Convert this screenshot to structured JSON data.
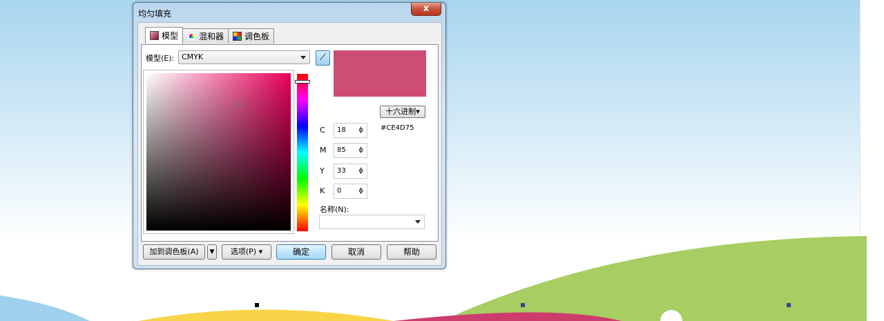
{
  "dialog": {
    "title": "均匀填充",
    "close_label": "x"
  },
  "tabs": [
    {
      "label": "模型",
      "icon": "model-swatch-icon"
    },
    {
      "label": "混和器",
      "icon": "color-wheel-icon"
    },
    {
      "label": "调色板",
      "icon": "palette-grid-icon"
    }
  ],
  "model": {
    "label": "模型(E):",
    "value": "CMYK"
  },
  "preview_color": "#CE4D75",
  "hex": {
    "format_button": "十六进制▾",
    "value": "#CE4D75"
  },
  "cmyk": [
    {
      "label": "C",
      "value": "18"
    },
    {
      "label": "M",
      "value": "85"
    },
    {
      "label": "Y",
      "value": "33"
    },
    {
      "label": "K",
      "value": "0"
    }
  ],
  "name": {
    "label": "名称(N):",
    "value": ""
  },
  "buttons": {
    "add_palette": "加到调色板(A)",
    "options": "选项(P) ▾",
    "ok": "确定",
    "cancel": "取消",
    "help": "帮助"
  },
  "colors": {
    "hue": "#e8005a",
    "green": "#a8cd62",
    "magenta": "#cc3d6d",
    "yellow": "#f8d548",
    "blue": "#9fd0ee"
  }
}
